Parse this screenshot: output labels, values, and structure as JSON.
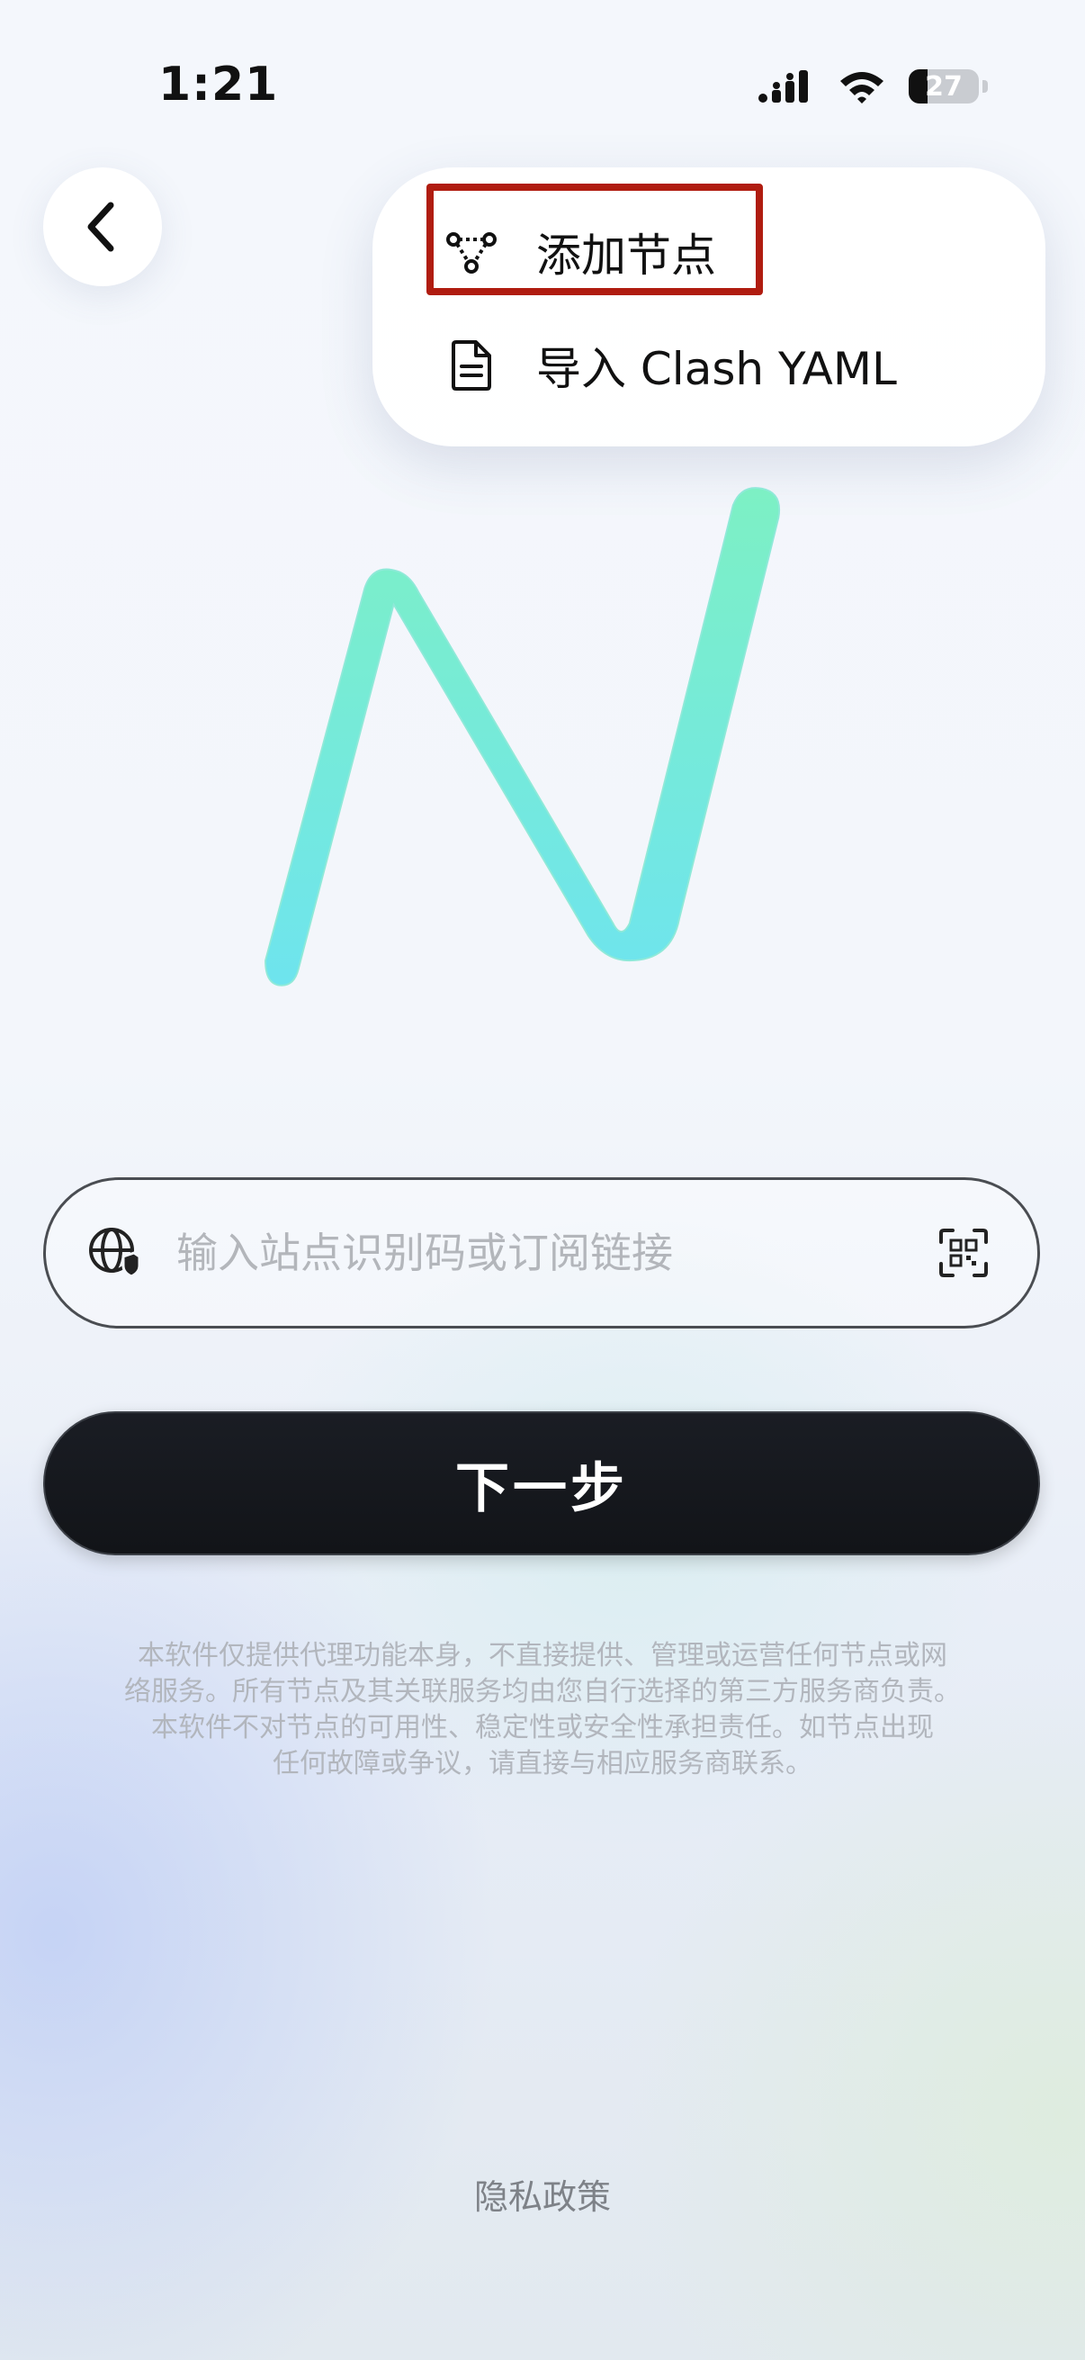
{
  "status_bar": {
    "time": "1:21",
    "battery_level": "27"
  },
  "menu": {
    "items": [
      {
        "label": "添加节点",
        "icon": "node-network-icon"
      },
      {
        "label": "导入 Clash YAML",
        "icon": "document-icon"
      }
    ],
    "highlighted_item": "添加节点",
    "highlight_color": "#b01c10"
  },
  "logo": {
    "letter": "N",
    "gradient_colors": [
      "#7df0c4",
      "#6ee4ee"
    ]
  },
  "input": {
    "placeholder": "输入站点识别码或订阅链接",
    "value": "",
    "left_icon": "globe-shield-icon",
    "right_icon": "qr-scan-icon"
  },
  "next_button": {
    "label": "下一步"
  },
  "disclaimer": {
    "lines": [
      "本软件仅提供代理功能本身，不直接提供、管理或运营任何节点或网",
      "络服务。所有节点及其关联服务均由您自行选择的第三方服务商负责。",
      "本软件不对节点的可用性、稳定性或安全性承担责任。如节点出现",
      "任何故障或争议，请直接与相应服务商联系。"
    ]
  },
  "footer": {
    "privacy_label": "隐私政策"
  }
}
